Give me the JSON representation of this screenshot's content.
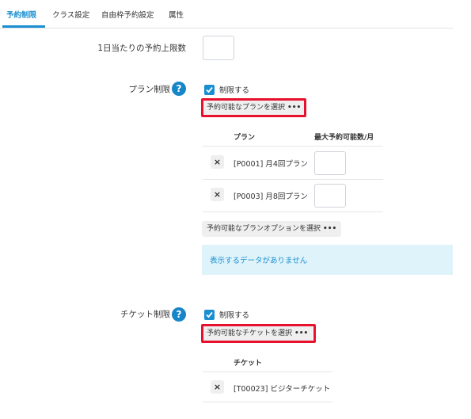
{
  "tabs": [
    {
      "label": "予約制限",
      "active": true
    },
    {
      "label": "クラス設定",
      "active": false
    },
    {
      "label": "自由枠予約設定",
      "active": false
    },
    {
      "label": "属性",
      "active": false
    }
  ],
  "daily_limit": {
    "label": "1日当たりの予約上限数",
    "value": ""
  },
  "plan_limit": {
    "label": "プラン制限",
    "help_icon": "?",
    "checkbox_label": "制限する",
    "checked": true,
    "select_button": "予約可能なプランを選択",
    "table_headers": [
      "プラン",
      "最大予約可能数/月"
    ],
    "rows": [
      {
        "name": "[P0001] 月4回プラン",
        "value": ""
      },
      {
        "name": "[P0003] 月8回プラン",
        "value": ""
      }
    ],
    "option_button": "予約可能なプランオプションを選択",
    "empty_message": "表示するデータがありません"
  },
  "ticket_limit": {
    "label": "チケット制限",
    "help_icon": "?",
    "checkbox_label": "制限する",
    "checked": true,
    "select_button": "予約可能なチケットを選択",
    "table_headers": [
      "チケット"
    ],
    "rows": [
      {
        "name": "[T00023] ビジターチケット"
      }
    ]
  },
  "icons": {
    "more": "•••",
    "remove": "×"
  },
  "colors": {
    "accent": "#1a8fd0",
    "highlight": "#e8112d",
    "empty_bg": "#dff3fb"
  }
}
